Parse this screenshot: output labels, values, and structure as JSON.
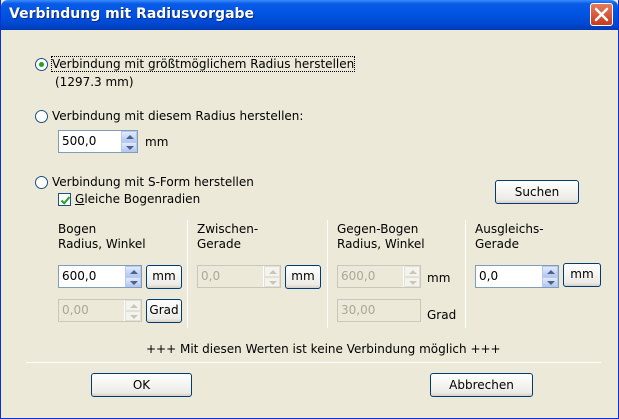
{
  "window": {
    "title": "Verbindung mit Radiusvorgabe"
  },
  "options": {
    "max_radius": {
      "label": "Verbindung mit größtmöglichem Radius herstellen",
      "value_text": "(1297.3 mm)",
      "selected": true
    },
    "given_radius": {
      "label": "Verbindung mit diesem Radius herstellen:",
      "value": "500,0",
      "unit": "mm",
      "selected": false
    },
    "s_form": {
      "label": "Verbindung mit S-Form herstellen",
      "selected": false
    }
  },
  "s_form": {
    "checkbox": {
      "underline_char": "G",
      "rest": "leiche Bogenradien",
      "checked": true
    },
    "search_button": "Suchen",
    "bogen": {
      "header_1": "Bogen",
      "header_2": "Radius, Winkel",
      "radius_value": "600,0",
      "angle_value": "0,00",
      "unit_button": "mm",
      "grad_button": "Grad"
    },
    "zwischen": {
      "header_1": "Zwischen-",
      "header_2": "Gerade",
      "value": "0,0",
      "unit_button": "mm"
    },
    "gegen": {
      "header_1": "Gegen-Bogen",
      "header_2": "Radius, Winkel",
      "radius_value": "600,0",
      "angle_value": "30,00",
      "unit": "mm",
      "grad": "Grad"
    },
    "ausgleich": {
      "header_1": "Ausgleichs-",
      "header_2": "Gerade",
      "value": "0,0",
      "unit_button": "mm"
    },
    "status": "+++ Mit diesen Werten ist keine Verbindung möglich +++"
  },
  "buttons": {
    "ok": "OK",
    "cancel": "Abbrechen"
  },
  "colors": {
    "titlebar": "#0054e3",
    "dialog_bg": "#ece9d8",
    "close": "#c8391c"
  }
}
